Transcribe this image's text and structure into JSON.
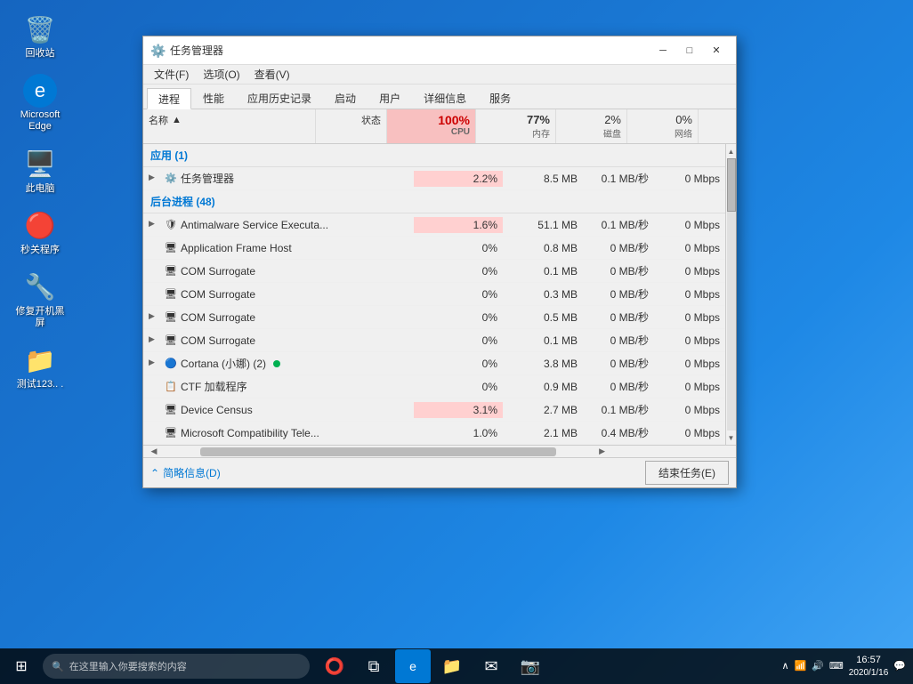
{
  "desktop": {
    "icons": [
      {
        "id": "recycle-bin",
        "label": "回收站",
        "emoji": "🗑️"
      },
      {
        "id": "edge",
        "label": "Microsoft Edge",
        "emoji": "🌐"
      },
      {
        "id": "computer",
        "label": "此电脑",
        "emoji": "💻"
      },
      {
        "id": "shutdown",
        "label": "秒关程序",
        "emoji": "🔴"
      },
      {
        "id": "fix-startup",
        "label": "修复开机黑屏",
        "emoji": "🔧"
      },
      {
        "id": "folder",
        "label": "测试123.. .",
        "emoji": "📁"
      }
    ]
  },
  "taskbar": {
    "search_placeholder": "在这里输入你要搜索的内容",
    "time": "16:57",
    "date": "2020/1/16"
  },
  "window": {
    "title": "任务管理器",
    "menubar": [
      "文件(F)",
      "选项(O)",
      "查看(V)"
    ],
    "tabs": [
      "进程",
      "性能",
      "应用历史记录",
      "启动",
      "用户",
      "详细信息",
      "服务"
    ],
    "active_tab": "进程",
    "columns": {
      "name": "名称",
      "status": "状态",
      "cpu_pct": "100%",
      "cpu_label": "CPU",
      "mem_pct": "77%",
      "mem_label": "内存",
      "disk_pct": "2%",
      "disk_label": "磁盘",
      "net_pct": "0%",
      "net_label": "网络"
    },
    "sections": [
      {
        "title": "应用 (1)",
        "type": "apps",
        "rows": [
          {
            "name": "任务管理器",
            "status": "",
            "cpu": "2.2%",
            "mem": "8.5 MB",
            "disk": "0.1 MB/秒",
            "net": "0 Mbps",
            "expandable": true,
            "icon": "⚙️"
          }
        ]
      },
      {
        "title": "后台进程 (48)",
        "type": "background",
        "rows": [
          {
            "name": "Antimalware Service Executa...",
            "status": "",
            "cpu": "1.6%",
            "mem": "51.1 MB",
            "disk": "0.1 MB/秒",
            "net": "0 Mbps",
            "expandable": true,
            "icon": "🛡"
          },
          {
            "name": "Application Frame Host",
            "status": "",
            "cpu": "0%",
            "mem": "0.8 MB",
            "disk": "0 MB/秒",
            "net": "0 Mbps",
            "expandable": false,
            "icon": "🖥"
          },
          {
            "name": "COM Surrogate",
            "status": "",
            "cpu": "0%",
            "mem": "0.1 MB",
            "disk": "0 MB/秒",
            "net": "0 Mbps",
            "expandable": false,
            "icon": "🖥"
          },
          {
            "name": "COM Surrogate",
            "status": "",
            "cpu": "0%",
            "mem": "0.3 MB",
            "disk": "0 MB/秒",
            "net": "0 Mbps",
            "expandable": false,
            "icon": "🖥"
          },
          {
            "name": "COM Surrogate",
            "status": "",
            "cpu": "0%",
            "mem": "0.5 MB",
            "disk": "0 MB/秒",
            "net": "0 Mbps",
            "expandable": true,
            "icon": "🖥"
          },
          {
            "name": "COM Surrogate",
            "status": "",
            "cpu": "0%",
            "mem": "0.1 MB",
            "disk": "0 MB/秒",
            "net": "0 Mbps",
            "expandable": true,
            "icon": "🖥"
          },
          {
            "name": "Cortana (小娜) (2)",
            "status": "",
            "cpu": "0%",
            "mem": "3.8 MB",
            "disk": "0 MB/秒",
            "net": "0 Mbps",
            "expandable": true,
            "icon": "🔵",
            "has_green_dot": true
          },
          {
            "name": "CTF 加载程序",
            "status": "",
            "cpu": "0%",
            "mem": "0.9 MB",
            "disk": "0 MB/秒",
            "net": "0 Mbps",
            "expandable": false,
            "icon": "📋"
          },
          {
            "name": "Device Census",
            "status": "",
            "cpu": "3.1%",
            "mem": "2.7 MB",
            "disk": "0.1 MB/秒",
            "net": "0 Mbps",
            "expandable": false,
            "icon": "🖥"
          },
          {
            "name": "Microsoft Compatibility Tele...",
            "status": "",
            "cpu": "1.0%",
            "mem": "2.1 MB",
            "disk": "0.4 MB/秒",
            "net": "0 Mbps",
            "expandable": false,
            "icon": "🖥"
          }
        ]
      }
    ],
    "bottom": {
      "summary_label": "简略信息(D)",
      "end_task_label": "结束任务(E)"
    }
  }
}
